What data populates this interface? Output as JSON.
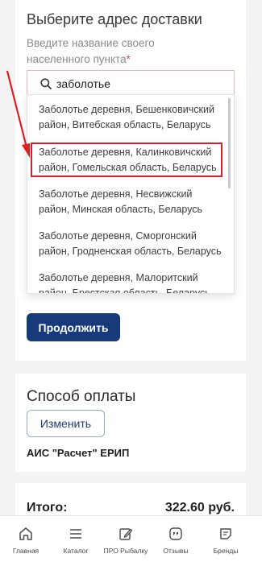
{
  "delivery": {
    "title": "Выберите адрес доставки",
    "field_label": "Введите название своего населенного пункта",
    "required_mark": "*",
    "search_value": "заболотье",
    "suggestions": [
      "Заболотье деревня, Бешенковичский район, Витебская область, Беларусь",
      "Заболотье деревня, Калинковичский район, Гомельская область, Беларусь",
      "Заболотье деревня, Несвижский район, Минская область, Беларусь",
      "Заболотье деревня, Сморгонский район, Гродненская область, Беларусь",
      "Заболотье деревня, Малоритский район, Брестская область, Беларусь"
    ],
    "highlighted_index": 1,
    "continue_label": "Продолжить"
  },
  "payment": {
    "title": "Способ оплаты",
    "change_label": "Изменить",
    "method": "АИС \"Расчет\" ЕРИП"
  },
  "total": {
    "label": "Итого:",
    "value": "322.60 руб."
  },
  "nav": [
    {
      "label": "Главная",
      "icon": "home-icon"
    },
    {
      "label": "Каталог",
      "icon": "catalog-list-icon"
    },
    {
      "label": "ПРО Рыбалку",
      "icon": "pencil-edit-icon"
    },
    {
      "label": "Отзывы",
      "icon": "reviews-quote-icon"
    },
    {
      "label": "Бренды",
      "icon": "brands-icon"
    }
  ],
  "colors": {
    "primary": "#163a7a",
    "highlight_border": "#d91f2a",
    "required": "#d84a4a"
  }
}
